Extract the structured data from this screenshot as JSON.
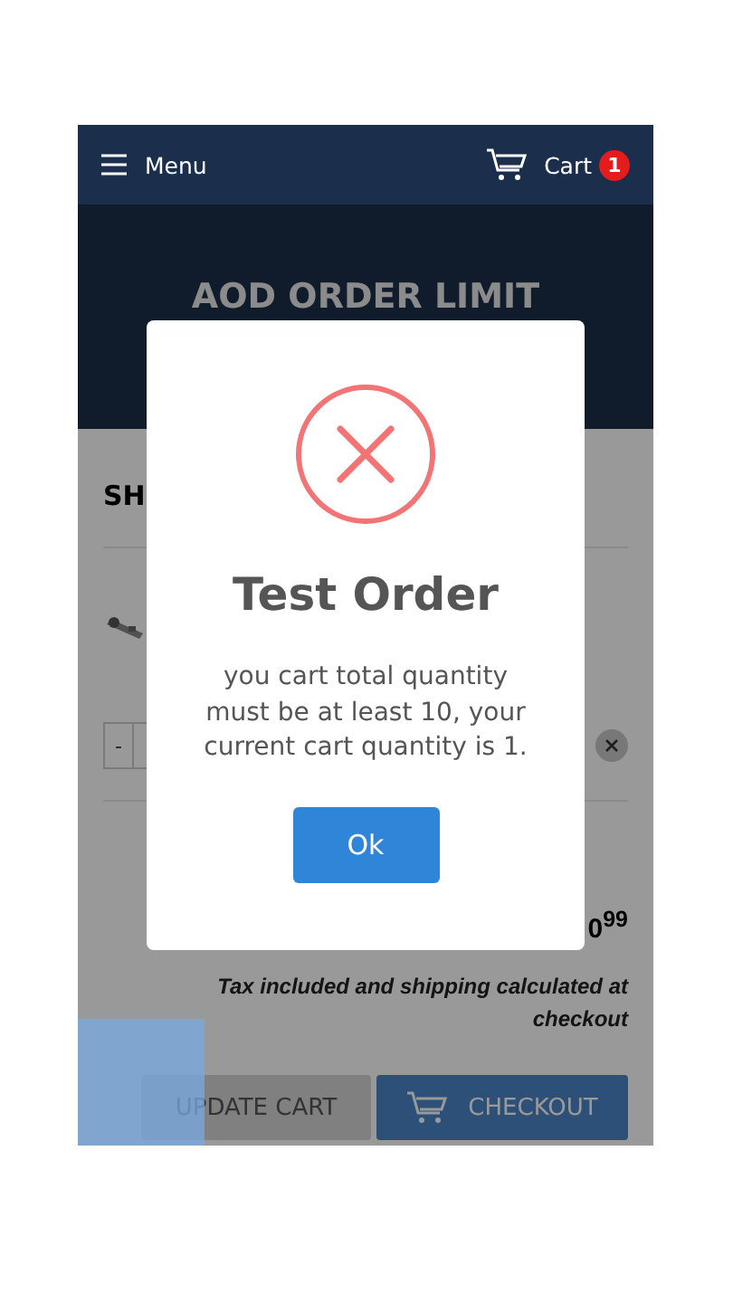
{
  "header": {
    "menu_label": "Menu",
    "cart_label": "Cart",
    "cart_count": "1"
  },
  "hero": {
    "title": "AOD ORDER LIMIT"
  },
  "cart": {
    "heading": "SH",
    "quantity_minus": "-",
    "price": "0$^{99}$",
    "tax_note": "Tax included and shipping calculated at checkout",
    "buttons": [
      {
        "label": "UPDATE CART",
        "kind": "secondary"
      },
      {
        "label": "CHECKOUT",
        "kind": "primary"
      }
    ]
  },
  "modal": {
    "kind": "error",
    "title": "Test Order",
    "message": "you cart total quantity must be at least 10, your current cart quantity is 1.",
    "button": "Ok"
  }
}
